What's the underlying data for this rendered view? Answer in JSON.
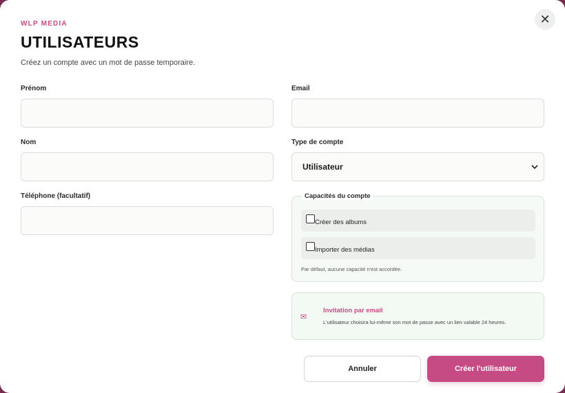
{
  "modal": {
    "brand": "WLP MEDIA",
    "title": "UTILISATEURS",
    "subtitle": "Créez un compte avec un mot de passe temporaire.",
    "close_icon": "close-icon"
  },
  "form": {
    "first_name": {
      "label": "Prénom",
      "value": "",
      "placeholder": ""
    },
    "email": {
      "label": "Email",
      "value": "",
      "placeholder": ""
    },
    "last_name": {
      "label": "Nom",
      "value": "",
      "placeholder": ""
    },
    "account_type": {
      "label": "Type de compte",
      "selected": "Utilisateur"
    },
    "phone": {
      "label": "Téléphone (facultatif)",
      "value": "",
      "placeholder": ""
    }
  },
  "capabilities": {
    "legend": "Capacités du compte",
    "items": [
      {
        "label": "Créer des albums",
        "checked": false
      },
      {
        "label": "Importer des médias",
        "checked": false
      }
    ],
    "hint": "Par défaut, aucune capacité n'est accordée."
  },
  "invite": {
    "icon": "mail-icon",
    "icon_glyph": "✉",
    "title": "Invitation par email",
    "text": "L'utilisateur choisira lui-même son mot de passe avec un lien valable 24 heures."
  },
  "actions": {
    "cancel_label": "Annuler",
    "create_label": "Créer l'utilisateur"
  },
  "colors": {
    "accent": "#c64b85",
    "panel_bg": "#f6faf6"
  }
}
